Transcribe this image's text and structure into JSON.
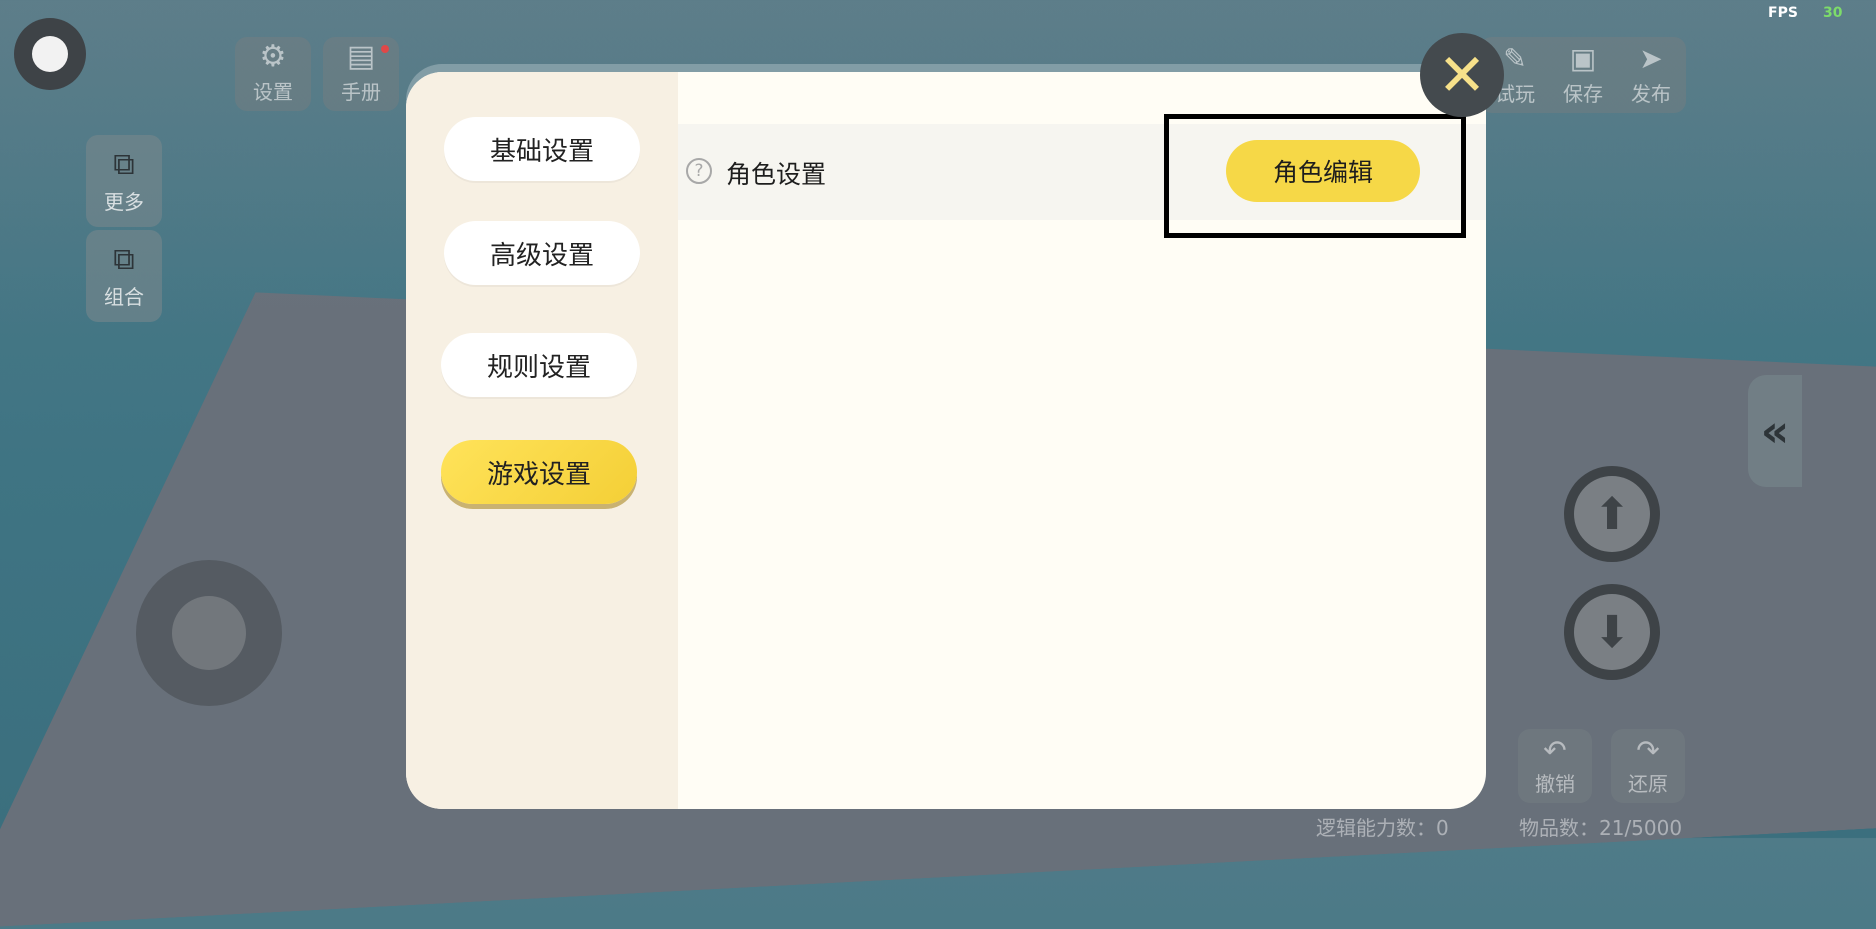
{
  "hud": {
    "fps_label": "FPS",
    "fps_value": "30",
    "settings_label": "设置",
    "manual_label": "手册",
    "more_label": "更多",
    "group_label": "组合",
    "test_play_label": "试玩",
    "save_label": "保存",
    "publish_label": "发布",
    "undo_label": "撤销",
    "redo_label": "还原",
    "logic_count": "逻辑能力数：0",
    "item_count": "物品数：21/5000",
    "collapse_glyph": "«",
    "icons": {
      "settings": "gear-icon",
      "manual": "book-icon",
      "more": "layers-icon",
      "group": "group-icon",
      "test_play": "pencil-icon",
      "save": "floppy-icon",
      "publish": "paper-plane-icon",
      "undo": "undo-icon",
      "redo": "redo-icon",
      "fly_up": "arrow-up-icon",
      "fly_down": "arrow-down-icon"
    }
  },
  "dialog": {
    "menu": [
      {
        "label": "基础设置",
        "active": false
      },
      {
        "label": "高级设置",
        "active": false
      },
      {
        "label": "规则设置",
        "active": false
      },
      {
        "label": "游戏设置",
        "active": true
      }
    ],
    "row": {
      "help_glyph": "?",
      "label": "角色设置",
      "button_label": "角色编辑"
    },
    "close_glyph": "✕"
  },
  "colors": {
    "accent_yellow": "#f6d847",
    "panel_bg": "#fffdf5",
    "side_bg": "#f7f0e3",
    "fps_green": "#7ddc6a"
  }
}
